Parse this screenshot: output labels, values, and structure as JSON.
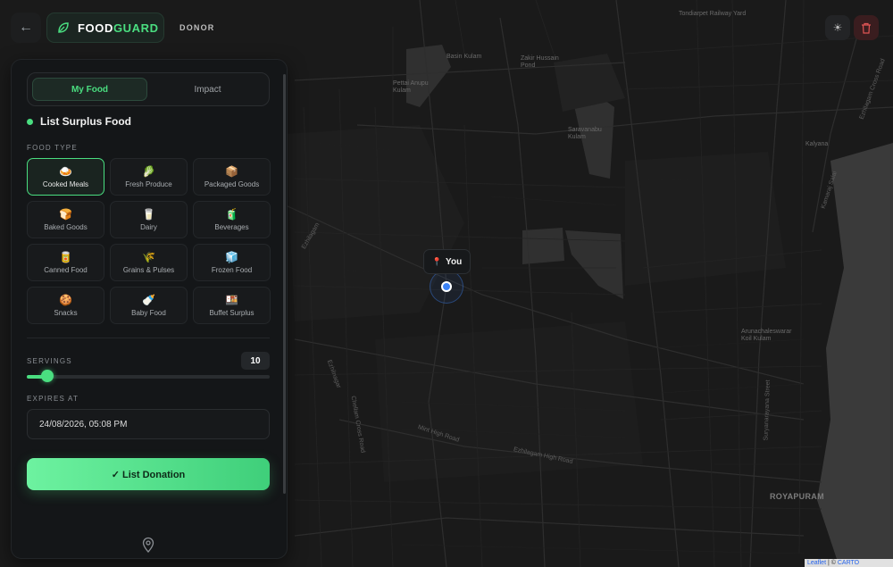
{
  "header": {
    "back_icon": "arrow-left-icon",
    "brand_icon": "leaf-icon",
    "brand_part1": "FOOD",
    "brand_part2": "GUARD",
    "role": "DONOR",
    "theme_icon": "sun-icon",
    "delete_icon": "trash-icon"
  },
  "tabs": [
    {
      "label": "My Food",
      "active": true
    },
    {
      "label": "Impact",
      "active": false
    }
  ],
  "form": {
    "title": "List Surplus Food",
    "food_type_label": "FOOD TYPE",
    "food_types": [
      {
        "label": "Cooked Meals",
        "icon": "🍛",
        "icon_name": "cooked-meals-icon",
        "selected": true
      },
      {
        "label": "Fresh Produce",
        "icon": "🥬",
        "icon_name": "leafy-greens-icon",
        "selected": false
      },
      {
        "label": "Packaged Goods",
        "icon": "📦",
        "icon_name": "package-icon",
        "selected": false
      },
      {
        "label": "Baked Goods",
        "icon": "🍞",
        "icon_name": "bread-icon",
        "selected": false
      },
      {
        "label": "Dairy",
        "icon": "🥛",
        "icon_name": "milk-icon",
        "selected": false
      },
      {
        "label": "Beverages",
        "icon": "🧃",
        "icon_name": "juice-box-icon",
        "selected": false
      },
      {
        "label": "Canned Food",
        "icon": "🥫",
        "icon_name": "canned-food-icon",
        "selected": false
      },
      {
        "label": "Grains & Pulses",
        "icon": "🌾",
        "icon_name": "grain-icon",
        "selected": false
      },
      {
        "label": "Frozen Food",
        "icon": "🧊",
        "icon_name": "ice-cube-icon",
        "selected": false
      },
      {
        "label": "Snacks",
        "icon": "🍪",
        "icon_name": "cookie-icon",
        "selected": false
      },
      {
        "label": "Baby Food",
        "icon": "🍼",
        "icon_name": "baby-bottle-icon",
        "selected": false
      },
      {
        "label": "Buffet Surplus",
        "icon": "🍱",
        "icon_name": "bento-icon",
        "selected": false
      }
    ],
    "servings_label": "SERVINGS",
    "servings_value": "10",
    "servings_fraction": 0.07,
    "expires_label": "EXPIRES AT",
    "expires_value": "24/08/2026, 05:08 PM",
    "submit_label": "✓ List Donation",
    "footer_icon": "map-pin-icon"
  },
  "map": {
    "user_marker_label": "You",
    "user_marker_icon": "pin-icon",
    "places": [
      {
        "name": "Tondiarpet Railway Yard",
        "text": "Tondiarpet\nRailway Yard"
      },
      {
        "name": "Basin Kulam",
        "text": "Basin Kulam"
      },
      {
        "name": "Zakir Hussain Pond",
        "text": "Zakir Hussain\nPond"
      },
      {
        "name": "Pettai Anupu Kulam",
        "text": "Pettai Anupu\nKulam"
      },
      {
        "name": "Saravana Kulam",
        "text": "Saravanabu\nKulam"
      },
      {
        "name": "Kalyana",
        "text": "Kalyana"
      },
      {
        "name": "Arunachaleswarar Koil Kulam",
        "text": "Arunachaleswarar\nKoil Kulam"
      },
      {
        "name": "ROYAPURAM",
        "text": "ROYAPURAM"
      }
    ],
    "streets": [
      {
        "name": "Ezhilagam",
        "text": "Ezhilagam"
      },
      {
        "name": "Ezhilnagar",
        "text": "Ezhilnagar"
      },
      {
        "name": "Chellam Cross Road",
        "text": "Chellam Cross Road"
      },
      {
        "name": "Mint High Road",
        "text": "Mint High Road"
      },
      {
        "name": "Ezhilagam High Road",
        "text": "Ezhilagam High Road"
      },
      {
        "name": "Suryanarayana Street",
        "text": "Suryanarayana Street"
      },
      {
        "name": "Kamaraj Salai",
        "text": "Kamaraj Salai"
      },
      {
        "name": "Ezhilagam Cross Road",
        "text": "Ezhilagam Cross Road"
      }
    ],
    "attribution_leaflet": "Leaflet",
    "attribution_sep": " | © ",
    "attribution_carto": "CARTO"
  }
}
